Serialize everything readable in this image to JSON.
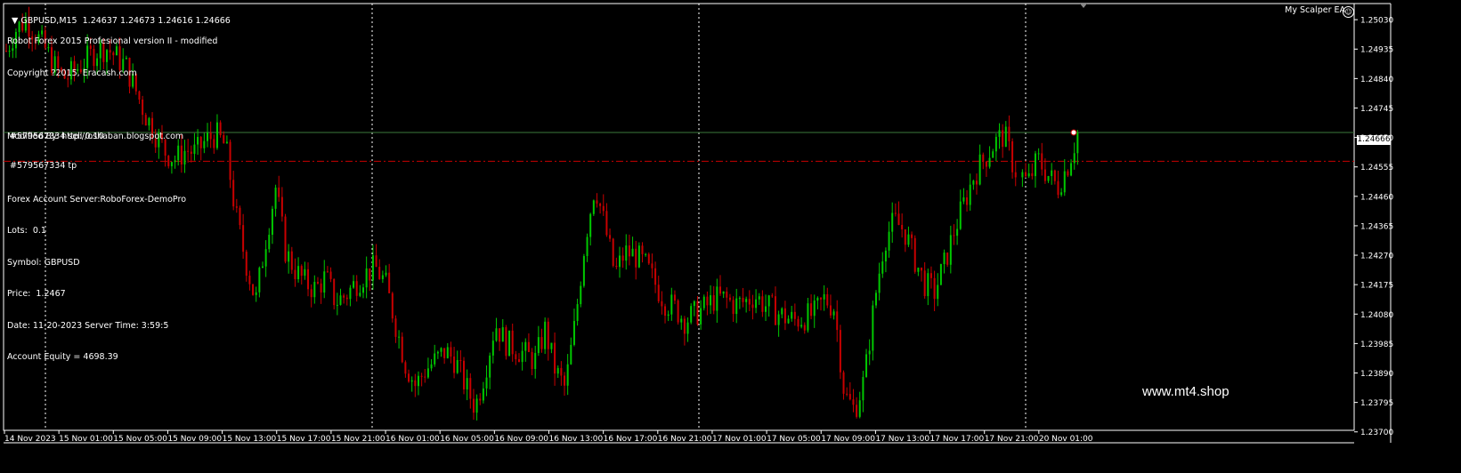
{
  "header": {
    "symbol_line": "GBPUSD,M15  1.24637 1.24673 1.24616 1.24666",
    "ea_name": "My Scalper EA"
  },
  "info": {
    "lines": [
      "Robot Forex 2015 Profesional version II - modified",
      "Copyright ?2015, Eracash.com",
      "",
      "Modified By: http://oshaban.blogspot.com",
      "",
      "Forex Account Server:RoboForex-DemoPro",
      "Lots:  0.1",
      "Symbol: GBPUSD",
      "Price:  1.2467",
      "Date: 11-20-2023 Server Time: 3:59:5",
      "Account Equity = 4698.39"
    ]
  },
  "orders": {
    "sell_label": "#579567334 sell 0.10",
    "tp_label": "#579567334 tp",
    "sell_price": 1.24666,
    "tp_price": 1.24573
  },
  "watermark": "www.mt4.shop",
  "current_price_label": "1.24666",
  "colors": {
    "background": "#000000",
    "bull": "#00c800",
    "bear": "#c80000",
    "grid": "#ffffff",
    "sell_line": "#3c7a3c",
    "tp_line": "#c80000"
  },
  "chart_data": {
    "type": "candlestick",
    "ylim": [
      1.23705,
      1.25082
    ],
    "y_ticks": [
      "1.25030",
      "1.24935",
      "1.24840",
      "1.24745",
      "1.24650",
      "1.24555",
      "1.24460",
      "1.24365",
      "1.24270",
      "1.24175",
      "1.24080",
      "1.23985",
      "1.23890",
      "1.23795",
      "1.23700"
    ],
    "y_tick_values": [
      1.2503,
      1.24935,
      1.2484,
      1.24745,
      1.2465,
      1.24555,
      1.2446,
      1.24365,
      1.2427,
      1.24175,
      1.2408,
      1.23985,
      1.2389,
      1.23795,
      1.237
    ],
    "x_labels": [
      "14 Nov 2023",
      "15 Nov 01:00",
      "15 Nov 05:00",
      "15 Nov 09:00",
      "15 Nov 13:00",
      "15 Nov 17:00",
      "15 Nov 21:00",
      "16 Nov 01:00",
      "16 Nov 05:00",
      "16 Nov 09:00",
      "16 Nov 13:00",
      "16 Nov 17:00",
      "16 Nov 21:00",
      "17 Nov 01:00",
      "17 Nov 05:00",
      "17 Nov 09:00",
      "17 Nov 13:00",
      "17 Nov 17:00",
      "17 Nov 21:00",
      "20 Nov 01:00"
    ],
    "close_path": [
      1.2493,
      1.25,
      1.2503,
      1.2498,
      1.2493,
      1.2487,
      1.2484,
      1.2487,
      1.249,
      1.2493,
      1.2494,
      1.2491,
      1.2488,
      1.248,
      1.2472,
      1.2466,
      1.246,
      1.2458,
      1.2461,
      1.246,
      1.2464,
      1.2466,
      1.2462,
      1.244,
      1.2425,
      1.2412,
      1.2432,
      1.2449,
      1.2428,
      1.2422,
      1.2418,
      1.2416,
      1.242,
      1.2412,
      1.2414,
      1.2418,
      1.2421,
      1.2423,
      1.2418,
      1.2405,
      1.2392,
      1.2385,
      1.239,
      1.2393,
      1.2396,
      1.2393,
      1.2385,
      1.2378,
      1.239,
      1.2405,
      1.2399,
      1.2397,
      1.2395,
      1.2393,
      1.2403,
      1.239,
      1.2384,
      1.2405,
      1.2432,
      1.245,
      1.2436,
      1.2421,
      1.2428,
      1.2427,
      1.2424,
      1.2418,
      1.2412,
      1.241,
      1.2406,
      1.2408,
      1.241,
      1.2413,
      1.2413,
      1.2411,
      1.2412,
      1.2414,
      1.2411,
      1.2409,
      1.2407,
      1.2406,
      1.2407,
      1.2408,
      1.2413,
      1.241,
      1.2382,
      1.2377,
      1.2387,
      1.2412,
      1.2432,
      1.2438,
      1.2435,
      1.2426,
      1.2418,
      1.2415,
      1.2424,
      1.2435,
      1.2444,
      1.2453,
      1.2458,
      1.2463,
      1.2466,
      1.2455,
      1.245,
      1.2458,
      1.2453,
      1.2449,
      1.2456,
      1.2466
    ]
  }
}
